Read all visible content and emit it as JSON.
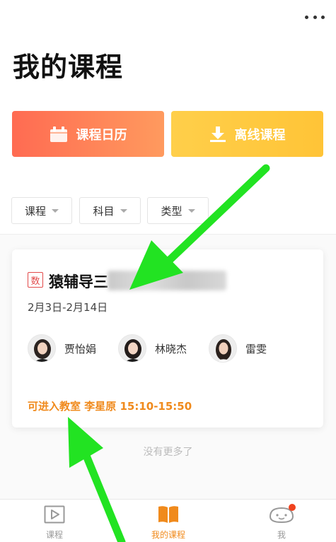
{
  "header": {
    "title": "我的课程"
  },
  "actions": {
    "calendar_label": "课程日历",
    "offline_label": "离线课程"
  },
  "filters": [
    {
      "label": "课程"
    },
    {
      "label": "科目"
    },
    {
      "label": "类型"
    }
  ],
  "course": {
    "subject_badge": "数",
    "title": "猿辅导三",
    "date_range": "2月3日-2月14日",
    "teachers": [
      {
        "name": "贾怡娟"
      },
      {
        "name": "林晓杰"
      },
      {
        "name": "雷雯"
      }
    ],
    "enter_class_text": "可进入教室 李星原 15:10-15:50"
  },
  "list_end_text": "没有更多了",
  "tabbar": {
    "tabs": [
      {
        "label": "课程",
        "icon": "play-icon"
      },
      {
        "label": "我的课程",
        "icon": "book-icon",
        "active": true
      },
      {
        "label": "我",
        "icon": "profile-icon",
        "has_badge": true
      }
    ]
  },
  "colors": {
    "calendar_button": "#ff7b55",
    "offline_button": "#ffc83f",
    "accent_orange": "#f08a1c",
    "annotation_arrow": "#22e322"
  }
}
